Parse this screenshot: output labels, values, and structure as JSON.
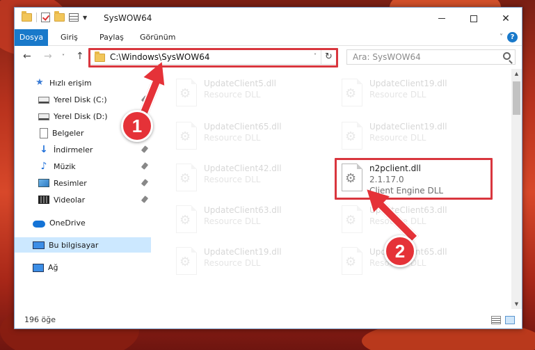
{
  "window": {
    "title": "SysWOW64"
  },
  "ribbon": {
    "tabs": [
      {
        "label": "Dosya"
      },
      {
        "label": "Giriş"
      },
      {
        "label": "Paylaş"
      },
      {
        "label": "Görünüm"
      }
    ],
    "help_label": "?"
  },
  "address": {
    "path": "C:\\Windows\\SysWOW64",
    "refresh_glyph": "↻"
  },
  "search": {
    "placeholder": "Ara: SysWOW64"
  },
  "sidebar": {
    "items": [
      {
        "label": "Hızlı erişim",
        "icon": "star-icon"
      },
      {
        "label": "Yerel Disk (C:)",
        "icon": "drive-icon"
      },
      {
        "label": "Yerel Disk (D:)",
        "icon": "drive-icon"
      },
      {
        "label": "Belgeler",
        "icon": "documents-icon"
      },
      {
        "label": "İndirmeler",
        "icon": "downloads-icon"
      },
      {
        "label": "Müzik",
        "icon": "music-icon"
      },
      {
        "label": "Resimler",
        "icon": "pictures-icon"
      },
      {
        "label": "Videolar",
        "icon": "videos-icon"
      },
      {
        "label": "OneDrive",
        "icon": "onedrive-icon"
      },
      {
        "label": "Bu bilgisayar",
        "icon": "computer-icon"
      },
      {
        "label": "Ağ",
        "icon": "network-icon"
      }
    ]
  },
  "files": [
    {
      "name": "UpdateClient5.dll",
      "sub1": "Resource DLL"
    },
    {
      "name": "UpdateClient19.dll",
      "sub1": "Resource DLL"
    },
    {
      "name": "UpdateClient65.dll",
      "sub1": "Resource DLL"
    },
    {
      "name": "UpdateClient19.dll",
      "sub1": "Resource DLL"
    },
    {
      "name": "UpdateClient42.dll",
      "sub1": "Resource DLL"
    },
    {
      "name": "n2pclient.dll",
      "sub1": "2.1.17.0",
      "sub2": "Client Engine DLL"
    },
    {
      "name": "UpdateClient63.dll",
      "sub1": "Resource DLL"
    },
    {
      "name": "UpdateClient63.dll",
      "sub1": "Resource DLL"
    },
    {
      "name": "UpdateClient19.dll",
      "sub1": "Resource DLL"
    },
    {
      "name": "UpdateClient65.dll",
      "sub1": "Resource DLL"
    }
  ],
  "status": {
    "count": "196 öğe"
  },
  "annotations": {
    "badge1": "1",
    "badge2": "2"
  },
  "colors": {
    "accent": "#1979ca",
    "highlight": "#d9363e",
    "selected": "#cce8ff"
  }
}
